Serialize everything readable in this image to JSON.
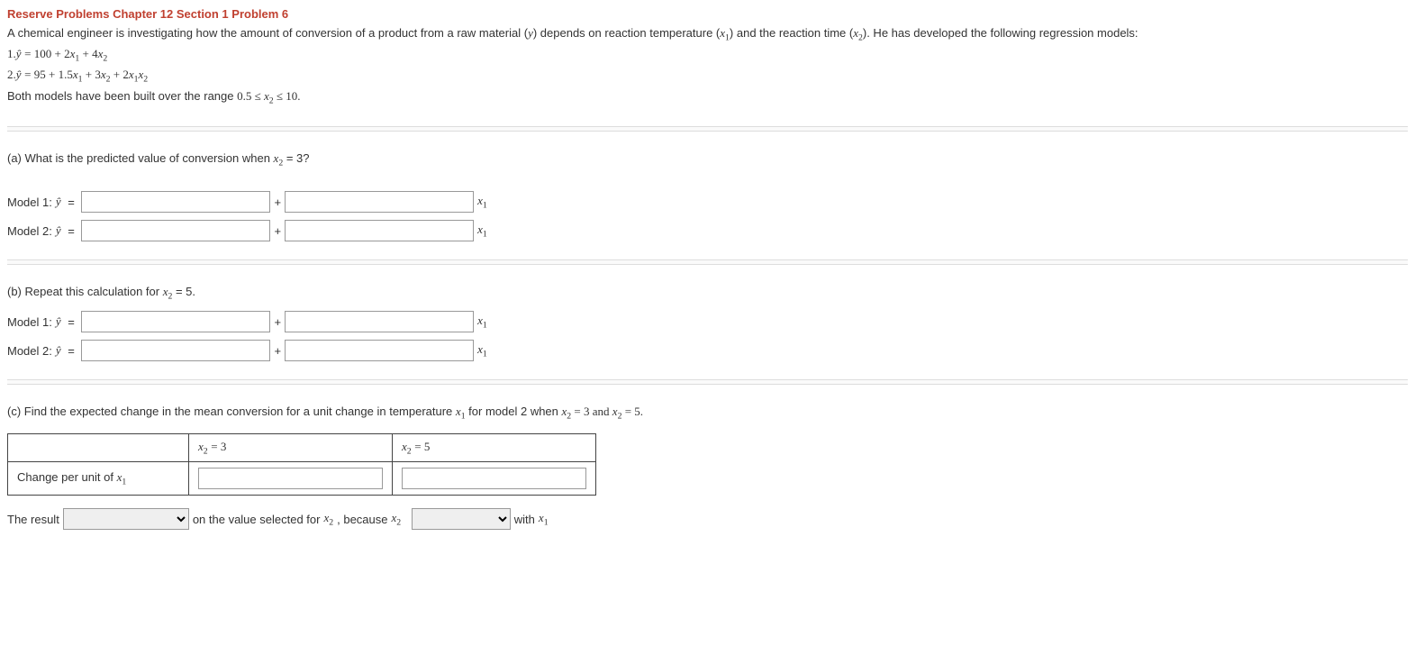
{
  "title": "Reserve Problems Chapter 12 Section 1 Problem 6",
  "intro": {
    "p1_a": "A chemical engineer is investigating how the amount of conversion of a product from a raw material (",
    "y": "y",
    "p1_b": ") depends on reaction temperature (",
    "x1": "x",
    "x1sub": "1",
    "p1_c": ") and the reaction time (",
    "x2": "x",
    "x2sub": "2",
    "p1_d": "). He has developed the following regression models:",
    "eq1_prefix": "1.",
    "eq1": "ŷ = 100 + 2x₁ + 4x₂",
    "eq2_prefix": "2.",
    "eq2": "ŷ = 95 + 1.5x₁ + 3x₂ + 2x₁x₂",
    "range_a": "Both models have been built over the range ",
    "range_b": "0.5 ≤ x₂ ≤ 10."
  },
  "part_a": {
    "q_a": "(a) What is the predicted value of conversion when ",
    "q_b": " = 3?",
    "m1_label": "Model 1: ",
    "m2_label": "Model 2: ",
    "yhat_eq": "ŷ =",
    "plus": "+",
    "trail": "x₁"
  },
  "part_b": {
    "q_a": "(b) Repeat this calculation for ",
    "q_b": " = 5.",
    "m1_label": "Model 1: ",
    "m2_label": "Model 2: ",
    "yhat_eq": "ŷ =",
    "plus": "+",
    "trail": "x₁"
  },
  "part_c": {
    "q_a": "(c) Find the expected change in the mean conversion for a unit change in temperature ",
    "q_b": " for model 2 when ",
    "q_c": " = 3 and ",
    "q_d": " = 5.",
    "header_blank": "",
    "header_1": "x₂ = 3",
    "header_2": "x₂ = 5",
    "rowlabel": "Change per unit of x₁",
    "result_a": "The result ",
    "result_b": " on the value selected for ",
    "result_c": ", because ",
    "result_d": " with ",
    "x1": "x₁",
    "x2": "x₂"
  }
}
